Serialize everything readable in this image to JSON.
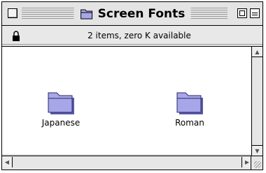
{
  "window": {
    "title": "Screen Fonts",
    "info": "2 items, zero K available",
    "icons": {
      "close": "close-box-icon",
      "title": "folder-icon",
      "zoom": "zoom-box-icon",
      "collapse": "collapse-box-icon",
      "lock": "lock-icon"
    }
  },
  "items": [
    {
      "label": "Japanese",
      "icon": "folder-icon"
    },
    {
      "label": "Roman",
      "icon": "folder-icon"
    }
  ],
  "colors": {
    "folder_fill": "#a6a6e8",
    "folder_shadow": "#5b5ba8"
  }
}
